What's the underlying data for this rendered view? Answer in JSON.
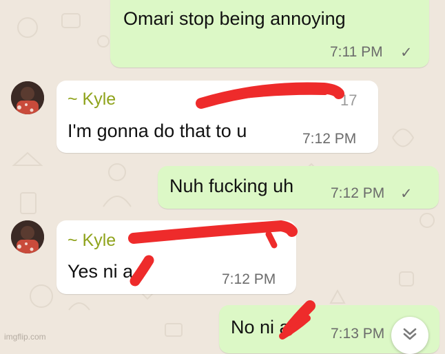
{
  "messages": [
    {
      "direction": "outgoing",
      "text": "Omari stop being annoying",
      "time": "7:11 PM",
      "status": "✓"
    },
    {
      "direction": "incoming",
      "sender": "~ Kyle",
      "sender_extra": "17",
      "text": "I'm gonna do that to u",
      "time": "7:12 PM"
    },
    {
      "direction": "outgoing",
      "text": "Nuh fucking uh",
      "time": "7:12 PM",
      "status": "✓"
    },
    {
      "direction": "incoming",
      "sender": "~ Kyle",
      "text": "Yes ni   a",
      "time": "7:12 PM"
    },
    {
      "direction": "outgoing",
      "text": "No ni   a",
      "time": "7:13 PM"
    }
  ],
  "watermark": "imgflip.com",
  "colors": {
    "outgoing_bubble": "#dcf8c6",
    "incoming_bubble": "#ffffff",
    "sender_name": "#8fa31c",
    "redaction": "#ee2b2b",
    "wallpaper": "#efe7dd"
  },
  "icons": {
    "scroll_down": "double-chevron-down-icon",
    "read_receipt": "check-icon"
  }
}
